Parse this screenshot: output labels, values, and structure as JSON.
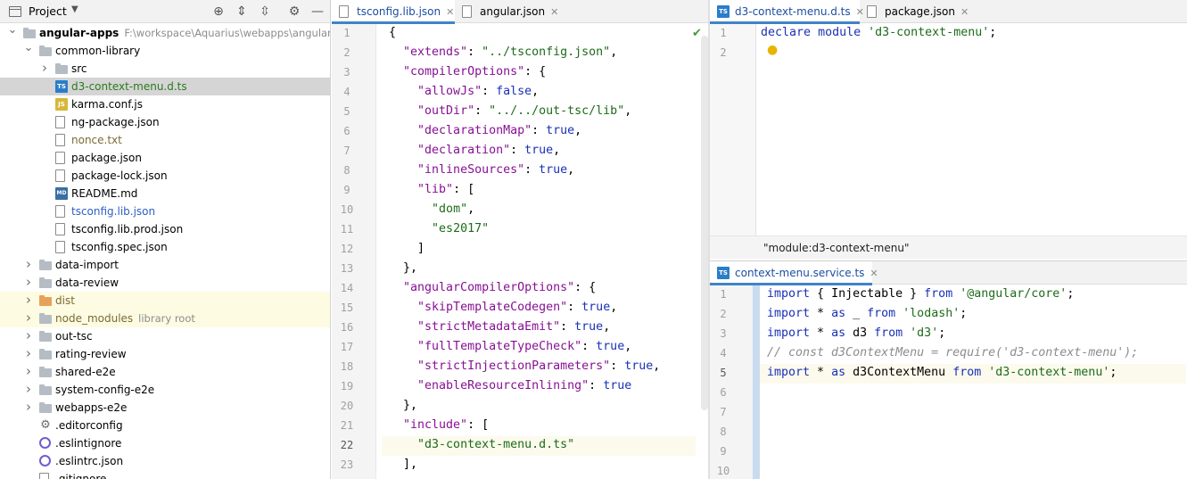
{
  "project_panel": {
    "title": "Project",
    "tree": [
      {
        "label": "angular-apps",
        "hint": "F:\\workspace\\Aquarius\\webapps\\angular-apps",
        "type": "folder",
        "depth": 0,
        "expanded": true,
        "color": "black"
      },
      {
        "label": "common-library",
        "type": "folder",
        "depth": 1,
        "expanded": true,
        "color": "black"
      },
      {
        "label": "src",
        "type": "folder",
        "depth": 2,
        "expanded": false,
        "color": "black"
      },
      {
        "label": "d3-context-menu.d.ts",
        "type": "ts",
        "depth": 2,
        "selected": true,
        "color": "green"
      },
      {
        "label": "karma.conf.js",
        "type": "js",
        "depth": 2,
        "color": "black"
      },
      {
        "label": "ng-package.json",
        "type": "json",
        "depth": 2,
        "color": "black"
      },
      {
        "label": "nonce.txt",
        "type": "txt",
        "depth": 2,
        "color": "olive"
      },
      {
        "label": "package.json",
        "type": "json",
        "depth": 2,
        "color": "black"
      },
      {
        "label": "package-lock.json",
        "type": "json",
        "depth": 2,
        "color": "black"
      },
      {
        "label": "README.md",
        "type": "md",
        "depth": 2,
        "color": "black"
      },
      {
        "label": "tsconfig.lib.json",
        "type": "json",
        "depth": 2,
        "color": "blue"
      },
      {
        "label": "tsconfig.lib.prod.json",
        "type": "json",
        "depth": 2,
        "color": "black"
      },
      {
        "label": "tsconfig.spec.json",
        "type": "json",
        "depth": 2,
        "color": "black"
      },
      {
        "label": "data-import",
        "type": "folder",
        "depth": 1,
        "expanded": false,
        "color": "black"
      },
      {
        "label": "data-review",
        "type": "folder",
        "depth": 1,
        "expanded": false,
        "color": "black"
      },
      {
        "label": "dist",
        "type": "folder-orange",
        "depth": 1,
        "expanded": false,
        "excluded": true,
        "color": "olive"
      },
      {
        "label": "node_modules",
        "hint": "library root",
        "type": "folder",
        "depth": 1,
        "expanded": false,
        "excluded": true,
        "color": "olive"
      },
      {
        "label": "out-tsc",
        "type": "folder",
        "depth": 1,
        "expanded": false,
        "color": "black"
      },
      {
        "label": "rating-review",
        "type": "folder",
        "depth": 1,
        "expanded": false,
        "color": "black"
      },
      {
        "label": "shared-e2e",
        "type": "folder",
        "depth": 1,
        "expanded": false,
        "color": "black"
      },
      {
        "label": "system-config-e2e",
        "type": "folder",
        "depth": 1,
        "expanded": false,
        "color": "black"
      },
      {
        "label": "webapps-e2e",
        "type": "folder",
        "depth": 1,
        "expanded": false,
        "color": "black"
      },
      {
        "label": ".editorconfig",
        "type": "gear",
        "depth": 1,
        "color": "black"
      },
      {
        "label": ".eslintignore",
        "type": "ring",
        "depth": 1,
        "color": "black"
      },
      {
        "label": ".eslintrc.json",
        "type": "ring",
        "depth": 1,
        "color": "black"
      },
      {
        "label": ".gitignore",
        "type": "txt",
        "depth": 1,
        "color": "black"
      }
    ]
  },
  "editor_left": {
    "tabs": [
      {
        "label": "tsconfig.lib.json",
        "active": true
      },
      {
        "label": "angular.json",
        "active": false
      }
    ],
    "lines": [
      [
        [
          "p",
          "{"
        ]
      ],
      [
        [
          "p",
          "  "
        ],
        [
          "k",
          "\"extends\""
        ],
        [
          "p",
          ": "
        ],
        [
          "s",
          "\"../tsconfig.json\""
        ],
        [
          "p",
          ","
        ]
      ],
      [
        [
          "p",
          "  "
        ],
        [
          "k",
          "\"compilerOptions\""
        ],
        [
          "p",
          ": {"
        ]
      ],
      [
        [
          "p",
          "    "
        ],
        [
          "k",
          "\"allowJs\""
        ],
        [
          "p",
          ": "
        ],
        [
          "w",
          "false"
        ],
        [
          "p",
          ","
        ]
      ],
      [
        [
          "p",
          "    "
        ],
        [
          "k",
          "\"outDir\""
        ],
        [
          "p",
          ": "
        ],
        [
          "s",
          "\"../../out-tsc/lib\""
        ],
        [
          "p",
          ","
        ]
      ],
      [
        [
          "p",
          "    "
        ],
        [
          "k",
          "\"declarationMap\""
        ],
        [
          "p",
          ": "
        ],
        [
          "w",
          "true"
        ],
        [
          "p",
          ","
        ]
      ],
      [
        [
          "p",
          "    "
        ],
        [
          "k",
          "\"declaration\""
        ],
        [
          "p",
          ": "
        ],
        [
          "w",
          "true"
        ],
        [
          "p",
          ","
        ]
      ],
      [
        [
          "p",
          "    "
        ],
        [
          "k",
          "\"inlineSources\""
        ],
        [
          "p",
          ": "
        ],
        [
          "w",
          "true"
        ],
        [
          "p",
          ","
        ]
      ],
      [
        [
          "p",
          "    "
        ],
        [
          "k",
          "\"lib\""
        ],
        [
          "p",
          ": ["
        ]
      ],
      [
        [
          "p",
          "      "
        ],
        [
          "s",
          "\"dom\""
        ],
        [
          "p",
          ","
        ]
      ],
      [
        [
          "p",
          "      "
        ],
        [
          "s",
          "\"es2017\""
        ]
      ],
      [
        [
          "p",
          "    ]"
        ]
      ],
      [
        [
          "p",
          "  },"
        ]
      ],
      [
        [
          "p",
          "  "
        ],
        [
          "k",
          "\"angularCompilerOptions\""
        ],
        [
          "p",
          ": {"
        ]
      ],
      [
        [
          "p",
          "    "
        ],
        [
          "k",
          "\"skipTemplateCodegen\""
        ],
        [
          "p",
          ": "
        ],
        [
          "w",
          "true"
        ],
        [
          "p",
          ","
        ]
      ],
      [
        [
          "p",
          "    "
        ],
        [
          "k",
          "\"strictMetadataEmit\""
        ],
        [
          "p",
          ": "
        ],
        [
          "w",
          "true"
        ],
        [
          "p",
          ","
        ]
      ],
      [
        [
          "p",
          "    "
        ],
        [
          "k",
          "\"fullTemplateTypeCheck\""
        ],
        [
          "p",
          ": "
        ],
        [
          "w",
          "true"
        ],
        [
          "p",
          ","
        ]
      ],
      [
        [
          "p",
          "    "
        ],
        [
          "k",
          "\"strictInjectionParameters\""
        ],
        [
          "p",
          ": "
        ],
        [
          "w",
          "true"
        ],
        [
          "p",
          ","
        ]
      ],
      [
        [
          "p",
          "    "
        ],
        [
          "k",
          "\"enableResourceInlining\""
        ],
        [
          "p",
          ": "
        ],
        [
          "w",
          "true"
        ]
      ],
      [
        [
          "p",
          "  },"
        ]
      ],
      [
        [
          "p",
          "  "
        ],
        [
          "k",
          "\"include\""
        ],
        [
          "p",
          ": ["
        ]
      ],
      [
        [
          "p",
          "    "
        ],
        [
          "s",
          "\"d3-context-menu.d.ts\""
        ]
      ],
      [
        [
          "p",
          "  ],"
        ]
      ]
    ],
    "current_line": 22
  },
  "editor_right_top": {
    "tabs": [
      {
        "label": "d3-context-menu.d.ts",
        "active": true
      },
      {
        "label": "package.json",
        "active": false
      }
    ],
    "lines": [
      [
        [
          "w",
          "declare"
        ],
        [
          "p",
          " "
        ],
        [
          "w",
          "module"
        ],
        [
          "p",
          " "
        ],
        [
          "s",
          "'d3-context-menu'"
        ],
        [
          "p",
          ";"
        ]
      ],
      []
    ],
    "breadcrumb": "\"module:d3-context-menu\""
  },
  "editor_right_bottom": {
    "tabs": [
      {
        "label": "context-menu.service.ts",
        "active": true
      }
    ],
    "lines": [
      [
        [
          "w",
          "import"
        ],
        [
          "p",
          " { "
        ],
        [
          "p",
          "Injectable"
        ],
        [
          "p",
          " } "
        ],
        [
          "w",
          "from"
        ],
        [
          "p",
          " "
        ],
        [
          "s",
          "'@angular/core'"
        ],
        [
          "p",
          ";"
        ]
      ],
      [
        [
          "w",
          "import"
        ],
        [
          "p",
          " * "
        ],
        [
          "w",
          "as"
        ],
        [
          "p",
          " _ "
        ],
        [
          "w",
          "from"
        ],
        [
          "p",
          " "
        ],
        [
          "s",
          "'lodash'"
        ],
        [
          "p",
          ";"
        ]
      ],
      [
        [
          "w",
          "import"
        ],
        [
          "p",
          " * "
        ],
        [
          "w",
          "as"
        ],
        [
          "p",
          " d3 "
        ],
        [
          "w",
          "from"
        ],
        [
          "p",
          " "
        ],
        [
          "s",
          "'d3'"
        ],
        [
          "p",
          ";"
        ]
      ],
      [
        [
          "c",
          "// const d3ContextMenu = require('d3-context-menu');"
        ]
      ],
      [
        [
          "w",
          "import"
        ],
        [
          "p",
          " * "
        ],
        [
          "w",
          "as"
        ],
        [
          "p",
          " d3ContextMenu "
        ],
        [
          "w",
          "from"
        ],
        [
          "p",
          " "
        ],
        [
          "s",
          "'d3-context-menu'"
        ],
        [
          "p",
          ";"
        ]
      ],
      [],
      [],
      [],
      [],
      []
    ],
    "current_line": 5
  },
  "colors": {
    "accent": "#4083c9",
    "key": "#871094",
    "string": "#1c6b19",
    "keyword": "#1a31b5",
    "selected_row": "#d5d5d5",
    "excluded_row": "#fdfbe2"
  }
}
